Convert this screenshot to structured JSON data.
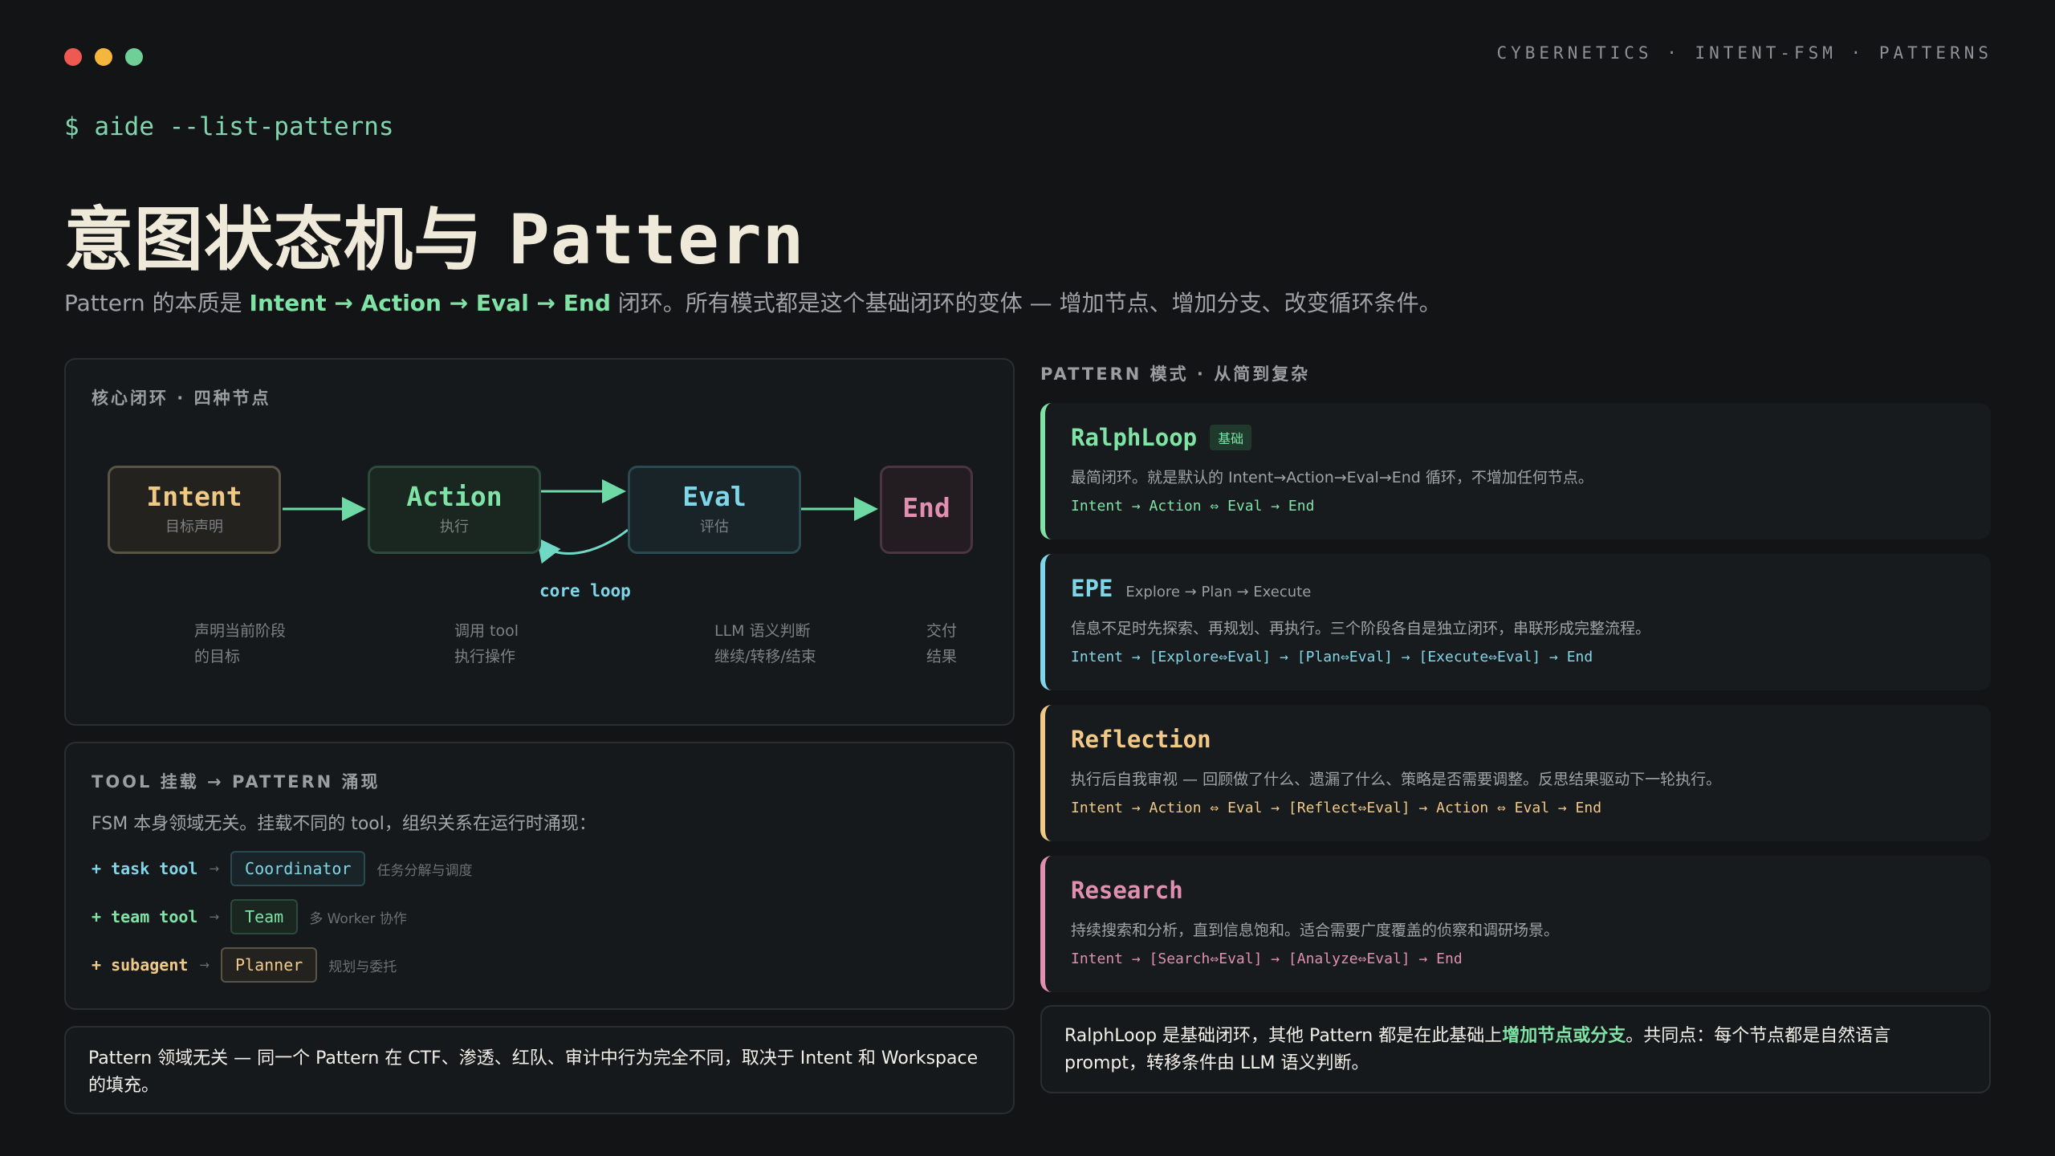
{
  "window": {
    "dot_colors": [
      "#ee5a52",
      "#f4b63c",
      "#6fcf97"
    ],
    "top_right": "CYBERNETICS · INTENT-FSM · PATTERNS"
  },
  "prompt": "$ aide --list-patterns",
  "title_cn": "意图状态机与",
  "title_en": "Pattern",
  "subtitle": {
    "prefix": "Pattern 的本质是 ",
    "highlight": "Intent → Action → Eval → End",
    "suffix": " 闭环。所有模式都是这个基础闭环的变体 — 增加节点、增加分支、改变循环条件。"
  },
  "core": {
    "label": "核心闭环 · 四种节点",
    "loop_label": "core loop",
    "nodes": [
      {
        "name": "Intent",
        "sub": "目标声明",
        "color": "#f0c987",
        "desc1": "声明当前阶段",
        "desc2": "的目标"
      },
      {
        "name": "Action",
        "sub": "执行",
        "color": "#7fe3a6",
        "desc1": "调用 tool",
        "desc2": "执行操作"
      },
      {
        "name": "Eval",
        "sub": "评估",
        "color": "#7fd6e8",
        "desc1": "LLM 语义判断",
        "desc2": "继续/转移/结束"
      },
      {
        "name": "End",
        "sub": "",
        "color": "#e08fb0",
        "desc1": "交付",
        "desc2": "结果"
      }
    ]
  },
  "tool": {
    "label": "TOOL 挂载 → PATTERN 涌现",
    "desc": "FSM 本身领域无关。挂载不同的 tool，组织关系在运行时涌现：",
    "rows": [
      {
        "key": "+ task tool",
        "pattern": "Coordinator",
        "note": "任务分解与调度",
        "color": "#7fd6e8"
      },
      {
        "key": "+ team tool",
        "pattern": "Team",
        "note": "多 Worker 协作",
        "color": "#7fe3a6"
      },
      {
        "key": "+ subagent",
        "pattern": "Planner",
        "note": "规划与委托",
        "color": "#f0c987"
      }
    ]
  },
  "note": "Pattern 领域无关 — 同一个 Pattern 在 CTF、渗透、红队、审计中行为完全不同，取决于 Intent 和 Workspace 的填充。",
  "patterns": {
    "header": "PATTERN 模式 · 从简到复杂",
    "cards": [
      {
        "name": "RalphLoop",
        "badge": "基础",
        "sub": "",
        "desc": "最简闭环。就是默认的 Intent→Action→Eval→End 循环，不增加任何节点。",
        "flow": "Intent → Action ⇔ Eval → End",
        "color": "#7fe3a6"
      },
      {
        "name": "EPE",
        "badge": "",
        "sub": "Explore → Plan → Execute",
        "desc": "信息不足时先探索、再规划、再执行。三个阶段各自是独立闭环，串联形成完整流程。",
        "flow": "Intent → [Explore⇔Eval] → [Plan⇔Eval] → [Execute⇔Eval] → End",
        "color": "#7fd6e8"
      },
      {
        "name": "Reflection",
        "badge": "",
        "sub": "",
        "desc": "执行后自我审视 — 回顾做了什么、遗漏了什么、策略是否需要调整。反思结果驱动下一轮执行。",
        "flow": "Intent → Action ⇔ Eval → [Reflect⇔Eval] → Action ⇔ Eval → End",
        "color": "#f0c987"
      },
      {
        "name": "Research",
        "badge": "",
        "sub": "",
        "desc": "持续搜索和分析，直到信息饱和。适合需要广度覆盖的侦察和调研场景。",
        "flow": "Intent → [Search⇔Eval] → [Analyze⇔Eval] → End",
        "color": "#e08fb0"
      }
    ],
    "summary": {
      "prefix": "RalphLoop 是基础闭环，其他 Pattern 都是在此基础上",
      "highlight": "增加节点或分支",
      "suffix": "。共同点：每个节点都是自然语言 prompt，转移条件由 LLM 语义判断。"
    }
  }
}
